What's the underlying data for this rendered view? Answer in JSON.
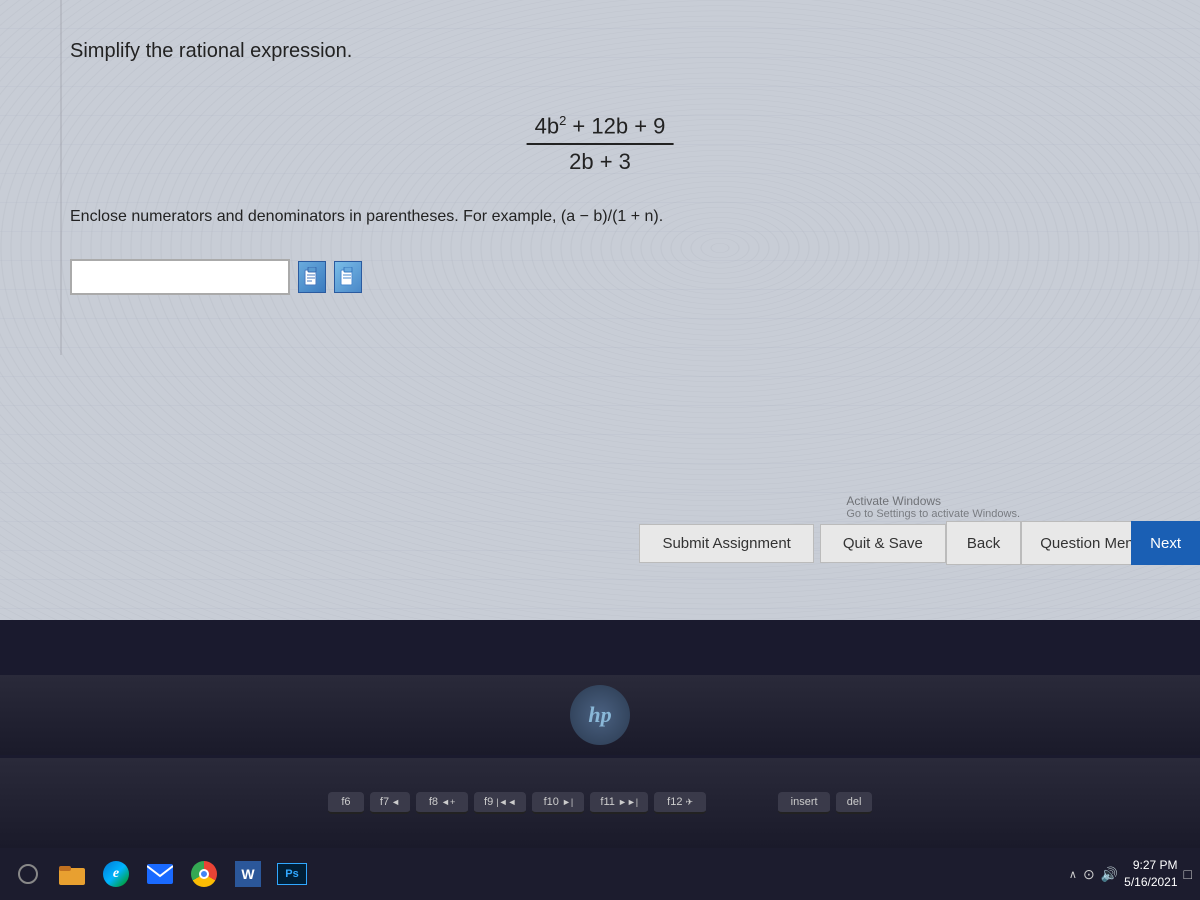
{
  "screen": {
    "background_color": "#c8cdd6"
  },
  "question": {
    "instruction": "Simplify the rational expression.",
    "fraction": {
      "numerator": "4b² + 12b + 9",
      "denominator": "2b + 3"
    },
    "hint": "Enclose numerators and denominators in parentheses. For example, (a − b)/(1 + n).",
    "answer_placeholder": ""
  },
  "buttons": {
    "submit_assignment": "Submit Assignment",
    "quit_save": "Quit & Save",
    "back": "Back",
    "question_menu": "Question Menu ▲",
    "next": "Next"
  },
  "activate_windows": "Activate Windows\nGo to Settings to activate Windows.",
  "taskbar": {
    "time": "9:27 PM",
    "date": "5/16/2021"
  },
  "keyboard_keys": [
    "f6",
    "f7",
    "f8",
    "f9",
    "f10",
    "f11",
    "f12",
    "insert",
    "del"
  ]
}
